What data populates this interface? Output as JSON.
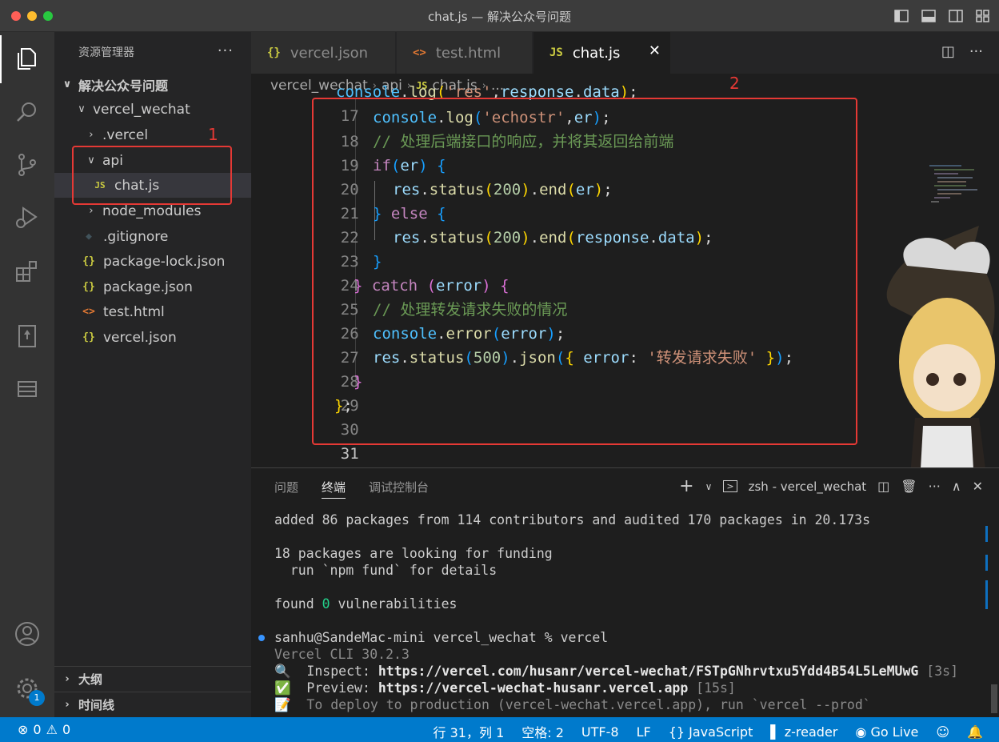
{
  "window": {
    "title": "chat.js — 解决公众号问题"
  },
  "colors": {
    "accent": "#007acc",
    "annotation": "#e53935"
  },
  "activity_bar": {
    "items": [
      "explorer-icon",
      "search-icon",
      "source-control-icon",
      "run-debug-icon",
      "extensions-icon",
      "bookmark-icon",
      "database-icon"
    ],
    "bottom": [
      "account-icon",
      "settings-gear-icon"
    ],
    "settings_badge": "1"
  },
  "sidebar": {
    "header": "资源管理器",
    "more": "···",
    "tree": [
      {
        "label": "解决公众号问题",
        "chevron": "∨"
      },
      {
        "label": "vercel_wechat",
        "chevron": "∨"
      },
      {
        "label": ".vercel",
        "chevron": "›"
      },
      {
        "label": "api",
        "chevron": "∨"
      },
      {
        "label": "chat.js",
        "icon": "JS"
      },
      {
        "label": "node_modules",
        "chevron": "›"
      },
      {
        "label": ".gitignore",
        "icon": "◆"
      },
      {
        "label": "package-lock.json",
        "icon": "{}"
      },
      {
        "label": "package.json",
        "icon": "{}"
      },
      {
        "label": "test.html",
        "icon": "<>"
      },
      {
        "label": "vercel.json",
        "icon": "{}"
      }
    ],
    "outline": "大纲",
    "timeline": "时间线"
  },
  "tabs": [
    {
      "label": "vercel.json",
      "icon": "{}"
    },
    {
      "label": "test.html",
      "icon": "<>"
    },
    {
      "label": "chat.js",
      "icon": "JS",
      "close": "✕"
    }
  ],
  "breadcrumb": {
    "folder": "vercel_wechat",
    "sub": "api",
    "icon": "JS",
    "file": "chat.js",
    "more": "..."
  },
  "code": {
    "line_numbers": [
      "18",
      "19",
      "20",
      "21",
      "22",
      "23",
      "24",
      "25",
      "26",
      "27",
      "28",
      "29",
      "30",
      "31"
    ],
    "comment_1": "// 处理后端接口的响应，并将其返回给前端",
    "comment_2": "// 处理转发请求失败的情况",
    "string_echostr": "'echostr'",
    "string_error": "'转发请求失败'",
    "num_200": "200",
    "num_500": "500"
  },
  "annotations": {
    "label_1": "1",
    "label_2": "2"
  },
  "panel": {
    "tabs": [
      "问题",
      "终端",
      "调试控制台"
    ],
    "active_tab": "终端",
    "terminal_name": "zsh - vercel_wechat",
    "terminal": {
      "added": "added 86 packages from 114 contributors and audited 170 packages in 20.173s",
      "funding": "18 packages are looking for funding",
      "fund_cmd": "  run `npm fund` for details",
      "found_pre": "found ",
      "found_num": "0",
      "found_post": " vulnerabilities",
      "prompt": "sanhu@SandeMac-mini vercel_wechat % vercel",
      "cli": "Vercel CLI 30.2.3",
      "inspect_label": "  Inspect: ",
      "inspect_url": "https://vercel.com/husanr/vercel-wechat/FSTpGNhrvtxu5Ydd4B54L5LeMUwG",
      "inspect_time": " [3s]",
      "preview_label": "  Preview: ",
      "preview_url": "https://vercel-wechat-husanr.vercel.app",
      "preview_time": " [15s]",
      "deploy": "  To deploy to production (vercel-wechat.vercel.app), run `vercel --prod`"
    }
  },
  "status_bar": {
    "errors": "0",
    "warnings": "0",
    "position": "行 31，列 1",
    "spaces": "空格: 2",
    "encoding": "UTF-8",
    "eol": "LF",
    "language": "JavaScript",
    "language_icon": "{}",
    "reader": "z-reader",
    "golive": "Go Live"
  }
}
